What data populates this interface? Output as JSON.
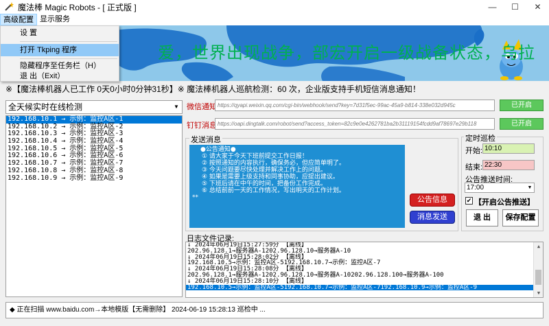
{
  "window": {
    "title": "魔法棒 Magic Robots - [ 正式版 ]",
    "minimize": "—",
    "maximize": "☐",
    "close": "✕"
  },
  "menu": {
    "items": [
      "高级配置",
      "显示服务"
    ],
    "dropdown": [
      "设 置",
      "打开 Tkping 程序",
      "隐藏程序至任务栏（H）",
      "退 出（Exit）"
    ]
  },
  "banner": {
    "text": "爱，世界出现战争，部宏开启一级战备状态，乌拉",
    "text_color": "#00b050",
    "sky_color": "#8ec8ea",
    "land_color": "#1a6fc8"
  },
  "status_line": "※【魔法棒机器人已工作 0天0小时0分钟31秒】※ 魔法棒机器人巡航检测：60 次，企业版支持手机短信消息通知！",
  "monitor": {
    "mode": "全天候实时在线检测",
    "hosts": [
      "192.168.10.1 → 示例：监控A区-1",
      "192.168.10.2 → 示例：监控A区-2",
      "192.168.10.3 → 示例：监控A区-3",
      "192.168.10.4 → 示例：监控A区-4",
      "192.168.10.5 → 示例：监控A区-5",
      "192.168.10.6 → 示例：监控A区-6",
      "192.168.10.7 → 示例：监控A区-7",
      "192.168.10.8 → 示例：监控A区-8",
      "192.168.10.9 → 示例：监控A区-9"
    ]
  },
  "notify": {
    "wechat_label": "微信通知：",
    "wechat_url": "https://qyapi.weixin.qq.com/cgi-bin/webhook/send?key=7d31f5ec-99ac-45a9-b814-338e032d945c",
    "wechat_btn": "已开启",
    "dingtalk_label": "钉钉消息：",
    "dingtalk_url": "https://oapi.dingtalk.com/robot/send?access_token=82c9e0e4262781ba2b31119154fcdd9af78697e29b118",
    "dingtalk_btn": "已开启"
  },
  "message": {
    "group_title": "发送消息",
    "lines": [
      "●公告通知●",
      "① 请大家于今天下班前提交工作日报！",
      "② 按照通知的内容执行，确保务必，但应简单明了。",
      "③ 今天问题要尽快处理并解决工作上的问题。",
      "④ 如果是需要上级支持和同事协助，应提出建议。",
      "⑤ 下班后请在中午的时间，把备份工作完成。",
      "⑥ 总结前前一天的工作情况，写出明天的工作计划。",
      "**"
    ],
    "notice_btn": "公告信息",
    "send_btn": "消息发送"
  },
  "timer": {
    "group_title": "定时巡检",
    "start_label": "开始:",
    "start_value": "10:10",
    "end_label": "结束:",
    "end_value": "22:30",
    "push_label": "公告推送时间:",
    "push_value": "17:00",
    "push_check_label": "【开启公告推送】",
    "push_checked": "✔",
    "exit_btn": "退 出",
    "save_btn": "保存配置",
    "start_bg": "#d9f2b3",
    "end_bg": "#f7c6c6"
  },
  "log": {
    "label": "日志文件记录:",
    "rows": [
      "↓ 2024年06月19日15:27:59分 【离线】",
      "202.96.128.1→服务器A-1202.96.128.10→服务器A-10",
      "↓ 2024年06月19日15:28:02分 【离线】",
      "192.168.10.5→示例：监控A区-5192.168.10.7→示例：监控A区-7",
      "↓ 2024年06月19日15:28:08分 【离线】",
      "202.96.128.1→服务器A-1202.96.128.10→服务器A-10202.96.128.100→服务器A-100",
      "↓ 2024年06月19日15:28:10分 【离线】",
      "192.168.10.5→示例：监控A区-5192.168.10.7→示例：监控A区-7192.168.10.9→示例：监控A区-9"
    ]
  },
  "statusbar": "◆ 正在扫描 www.baidu.com→本地模版【无需删除】 2024-06-19 15:28:13 巡检中 ..."
}
